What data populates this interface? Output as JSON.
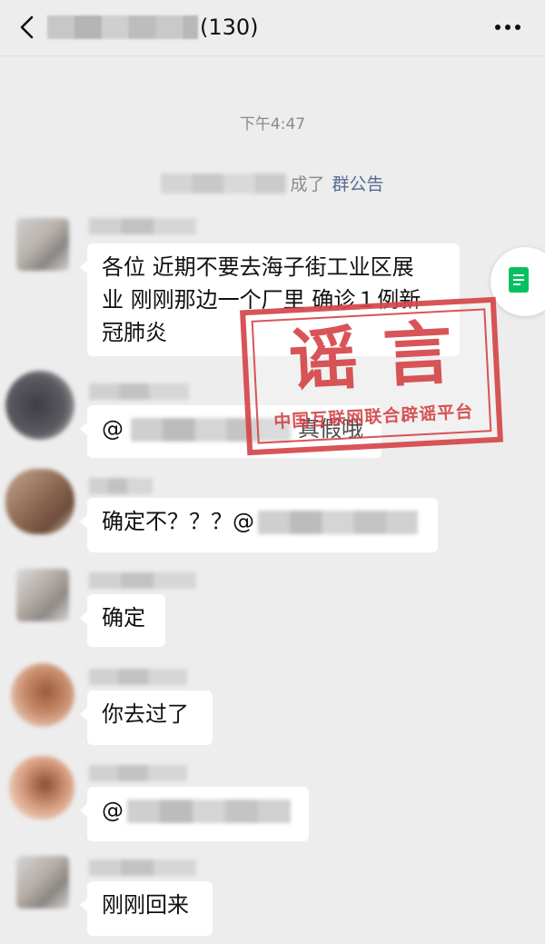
{
  "header": {
    "title_count": "(130)",
    "back_icon": "chevron-left-icon",
    "more_icon": "more-dots-icon"
  },
  "timestamp": "下午4:47",
  "notice": {
    "suffix": "成了",
    "link": "群公告"
  },
  "messages": [
    {
      "text_lines": [
        "各位  近期不要去海子街工业区展",
        "业  刚刚那边一个厂里  确诊１例新",
        "冠肺炎"
      ]
    },
    {
      "prefix": "@",
      "suffix": "真假哦"
    },
    {
      "text": "确定不？？？@"
    },
    {
      "text": "确定"
    },
    {
      "text": "你去过了"
    },
    {
      "prefix": "@"
    },
    {
      "text": "刚刚回来"
    }
  ],
  "stamp": {
    "big": "谣言",
    "small": "中国互联网联合辟谣平台",
    "color": "#d5464a"
  },
  "colors": {
    "background": "#ededed",
    "bubble": "#ffffff",
    "link": "#576b95",
    "float_icon": "#07c160"
  }
}
